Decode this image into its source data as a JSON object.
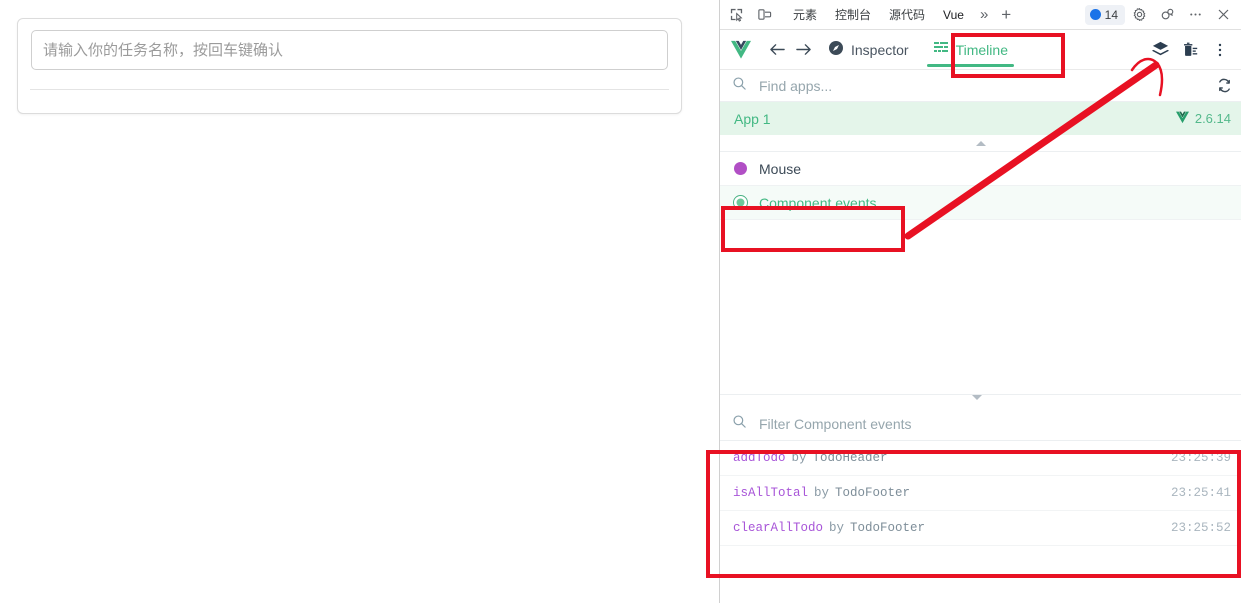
{
  "page": {
    "todo_input_placeholder": "请输入你的任务名称，按回车键确认",
    "todo_input_value": ""
  },
  "devtools": {
    "browser_tabs": {
      "inspect_icon": "inspect-element-icon",
      "device_icon": "device-toolbar-icon",
      "tabs": [
        {
          "label": "元素",
          "active": false
        },
        {
          "label": "控制台",
          "active": false
        },
        {
          "label": "源代码",
          "active": false
        },
        {
          "label": "Vue",
          "active": true
        }
      ],
      "more_tabs": "»",
      "add_tab": "+",
      "issues_count": "14",
      "settings_icon": "gear-icon",
      "feedback_icon": "feedback-icon",
      "more_icon": "more-options-icon",
      "close_icon": "close-icon"
    },
    "vue_bar": {
      "logo": "vue-logo-icon",
      "back": "arrow-left-icon",
      "forward": "arrow-right-icon",
      "tabs": [
        {
          "label": "Inspector",
          "icon": "compass-icon",
          "selected": false
        },
        {
          "label": "Timeline",
          "icon": "timeline-grid-icon",
          "selected": true
        }
      ],
      "layers_icon": "layers-icon",
      "clear_icon": "trash-clear-icon",
      "menu_icon": "vertical-dots-icon"
    },
    "find_apps": {
      "icon": "search-icon",
      "placeholder": "Find apps...",
      "value": "",
      "refresh_icon": "refresh-icon"
    },
    "app_row": {
      "name": "App 1",
      "version": "2.6.14",
      "version_icon": "vue-logo-icon"
    },
    "layers": [
      {
        "label": "Mouse",
        "color": "#b14fc5",
        "selected": false
      },
      {
        "label": "Component events",
        "color": "#49b184",
        "selected": true
      }
    ],
    "event_filter": {
      "icon": "search-icon",
      "placeholder": "Filter Component events",
      "value": ""
    },
    "events": {
      "by_word": "by",
      "rows": [
        {
          "name": "addTodo",
          "component": "TodoHeader",
          "time": "23:25:39"
        },
        {
          "name": "isAllTotal",
          "component": "TodoFooter",
          "time": "23:25:41"
        },
        {
          "name": "clearAllTodo",
          "component": "TodoFooter",
          "time": "23:25:52"
        }
      ]
    }
  },
  "annotations": {
    "color": "#e81123",
    "boxes": [
      "timeline-tab",
      "component-events-layer",
      "event-list"
    ],
    "arrow": "points-from-component-events-to-layers-button"
  },
  "colors": {
    "vue_green": "#42b883",
    "annotation_red": "#e81123",
    "event_name_purple": "#a855d8",
    "mouse_purple": "#b14fc5",
    "issue_blue": "#1a73e8"
  }
}
